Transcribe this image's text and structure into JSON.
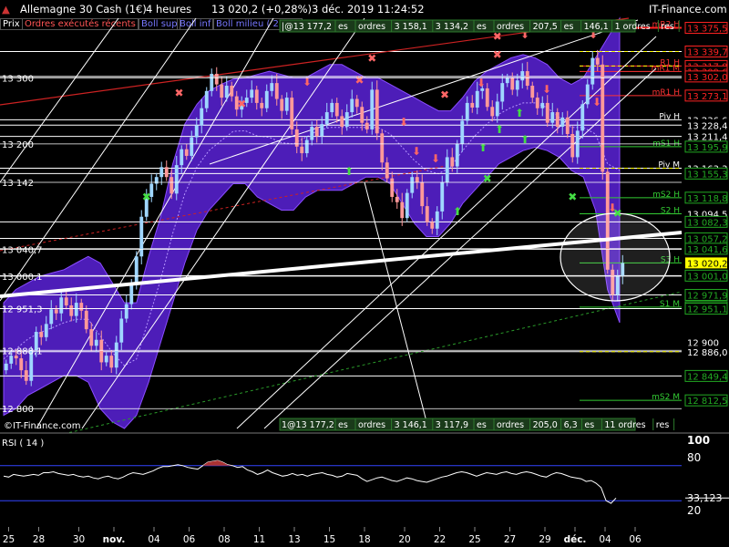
{
  "header": {
    "title": "Allemagne 30 Cash (1€)",
    "period": "4 heures",
    "last": "13 020,2 (+0,28%)",
    "datetime": "3 déc. 2019 11:24:52",
    "brand": "IT-Finance.com"
  },
  "tabs": [
    {
      "label": "Prix",
      "color": "#ffffff"
    },
    {
      "label": "Ordres exécutés récents",
      "color": "#ff5555"
    },
    {
      "label": "Boll sup",
      "color": "#7777ff"
    },
    {
      "label": "Boll inf",
      "color": "#7777ff"
    },
    {
      "label": "Boll milieu ( 20 ,2)",
      "color": "#7777ff"
    }
  ],
  "order_bar_top": [
    "|@13 177,2",
    "es",
    "ordres",
    "3 158,1",
    "3 134,2",
    "es",
    "ordres",
    "207,5",
    "es",
    "146,1",
    "1 ordres",
    "res"
  ],
  "order_bar_bottom": [
    "1@13 177,2",
    "es",
    "ordres",
    "3 146,1",
    "3 117,9",
    "es",
    "ordres",
    "205,0",
    "6,3",
    "es",
    "11 ordres",
    "res"
  ],
  "watermark": "©IT-Finance.com",
  "chart_data": {
    "type": "candlestick",
    "instrument": "Allemagne 30 Cash (1€)",
    "timeframe": "4 heures",
    "ylim": [
      12770,
      13390
    ],
    "yticks": [
      {
        "value": 13300,
        "label": "13 300"
      },
      {
        "value": 13200,
        "label": "13 200"
      },
      {
        "value": 13142,
        "label": "13 142"
      },
      {
        "value": 13040.7,
        "label": "13 040,7"
      },
      {
        "value": 13000.1,
        "label": "13 000,1"
      },
      {
        "value": 12951.3,
        "label": "12 951,3"
      },
      {
        "value": 12888.1,
        "label": "12 888,1"
      },
      {
        "value": 12800,
        "label": "12 800"
      }
    ],
    "xticks": [
      "25",
      "28",
      "30",
      "nov.",
      "04",
      "06",
      "08",
      "11",
      "13",
      "15",
      "18",
      "20",
      "22",
      "25",
      "27",
      "29",
      "déc.",
      "04",
      "06"
    ],
    "xlim_bars": [
      0,
      124
    ],
    "xtick_bars": [
      1,
      7,
      15,
      22,
      30,
      37,
      44,
      51,
      58,
      65,
      72,
      80,
      87,
      94,
      101,
      108,
      114,
      120,
      126
    ],
    "closes": [
      12868,
      12880,
      12876,
      12858,
      12842,
      12888,
      12916,
      12908,
      12928,
      12950,
      12944,
      12968,
      12956,
      12940,
      12960,
      12948,
      12920,
      12895,
      12904,
      12870,
      12880,
      12862,
      12900,
      12936,
      12958,
      12990,
      13030,
      13090,
      13120,
      13140,
      13150,
      13165,
      13150,
      13125,
      13168,
      13192,
      13182,
      13210,
      13228,
      13254,
      13280,
      13306,
      13290,
      13270,
      13288,
      13272,
      13252,
      13262,
      13270,
      13282,
      13262,
      13254,
      13280,
      13292,
      13268,
      13250,
      13270,
      13222,
      13196,
      13186,
      13206,
      13226,
      13212,
      13230,
      13248,
      13262,
      13242,
      13226,
      13248,
      13268,
      13256,
      13232,
      13222,
      13282,
      13216,
      13172,
      13148,
      13120,
      13112,
      13088,
      13126,
      13150,
      13142,
      13106,
      13082,
      13072,
      13098,
      13142,
      13180,
      13166,
      13200,
      13235,
      13262,
      13255,
      13280,
      13284,
      13256,
      13242,
      13264,
      13292,
      13300,
      13282,
      13296,
      13310,
      13288,
      13270,
      13254,
      13262,
      13232,
      13248,
      13226,
      13240,
      13215,
      13180,
      13220,
      13260,
      13290,
      13330,
      13320,
      13158,
      13010,
      12972,
      13000,
      13020
    ],
    "bollinger": {
      "upper": [
        12960,
        12980,
        12990,
        13000,
        13005,
        13010,
        13020,
        13030,
        13020,
        12990,
        12960,
        12960,
        13030,
        13090,
        13170,
        13230,
        13260,
        13280,
        13290,
        13298,
        13300,
        13305,
        13310,
        13305,
        13300,
        13300,
        13310,
        13320,
        13320,
        13310,
        13300,
        13300,
        13290,
        13280,
        13270,
        13260,
        13250,
        13250,
        13270,
        13295,
        13310,
        13320,
        13330,
        13335,
        13330,
        13320,
        13300,
        13290,
        13300,
        13330,
        13360,
        13390
      ],
      "lower": [
        12790,
        12800,
        12820,
        12830,
        12840,
        12850,
        12850,
        12840,
        12800,
        12780,
        12770,
        12790,
        12840,
        12900,
        12960,
        13020,
        13070,
        13100,
        13120,
        13140,
        13140,
        13120,
        13110,
        13100,
        13100,
        13120,
        13130,
        13130,
        13130,
        13140,
        13150,
        13150,
        13140,
        13110,
        13080,
        13060,
        13060,
        13080,
        13110,
        13130,
        13150,
        13170,
        13180,
        13190,
        13195,
        13190,
        13180,
        13160,
        13150,
        13100,
        12980,
        12930
      ],
      "middle": [
        12875,
        12890,
        12905,
        12915,
        12922,
        12930,
        12935,
        12935,
        12910,
        12885,
        12865,
        12875,
        12935,
        12995,
        13065,
        13125,
        13165,
        13190,
        13205,
        13219,
        13220,
        13212,
        13210,
        13202,
        13200,
        13210,
        13220,
        13225,
        13225,
        13225,
        13225,
        13225,
        13215,
        13195,
        13175,
        13160,
        13155,
        13165,
        13190,
        13212,
        13230,
        13245,
        13255,
        13262,
        13262,
        13255,
        13240,
        13225,
        13225,
        13215,
        13170,
        13160
      ]
    },
    "pivots": [
      {
        "label": "mR2 H",
        "value": 13375.5,
        "color": "#ff3333"
      },
      {
        "label": "",
        "value": 13339.7,
        "color": "#ffffff"
      },
      {
        "label": "R1 H",
        "value": 13317.8,
        "color": "#ff3333"
      },
      {
        "label": "mR1 M",
        "value": 13309.6,
        "color": "#ff3333"
      },
      {
        "label": "",
        "value": 13302.0,
        "color": "#ffffff"
      },
      {
        "label": "mR1 H",
        "value": 13273.1,
        "color": "#ff3333"
      },
      {
        "label": "Piv H",
        "value": 13236.6,
        "color": "#ffffff"
      },
      {
        "label": "",
        "value": 13228.4,
        "color": "#ffffff"
      },
      {
        "label": "",
        "value": 13211.4,
        "color": "#ffffff"
      },
      {
        "label": "mS1 H",
        "value": 13195.9,
        "color": "#33cc33"
      },
      {
        "label": "Piv M",
        "value": 13163.3,
        "color": "#ffffff"
      },
      {
        "label": "",
        "value": 13155.3,
        "color": "#ffffff"
      },
      {
        "label": "mS2 H",
        "value": 13118.8,
        "color": "#33cc33"
      },
      {
        "label": "S2 H",
        "value": 13094.5,
        "color": "#33cc33"
      },
      {
        "label": "",
        "value": 13082.3,
        "color": "#ffffff"
      },
      {
        "label": "",
        "value": 13057.2,
        "color": "#ffffff"
      },
      {
        "label": "",
        "value": 13041.6,
        "color": "#ffffff"
      },
      {
        "label": "S3 H",
        "value": 13020.2,
        "color": "#33cc33"
      },
      {
        "label": "",
        "value": 13001.0,
        "color": "#ffffff"
      },
      {
        "label": "",
        "value": 12971.9,
        "color": "#ffffff"
      },
      {
        "label": "S1 M",
        "value": 12953.4,
        "color": "#33cc33"
      },
      {
        "label": "",
        "value": 12951.1,
        "color": "#ffffff"
      },
      {
        "label": "",
        "value": 12886.0,
        "color": "#ffffff"
      },
      {
        "label": "",
        "value": 12849.4,
        "color": "#ffffff"
      },
      {
        "label": "mS2 M",
        "value": 12812.5,
        "color": "#33cc33"
      }
    ],
    "price_labels": [
      {
        "value": 13375.5,
        "label": "13 375,5",
        "color": "#ff2222"
      },
      {
        "value": 13339.7,
        "label": "13 339,7",
        "color": "#ff2222"
      },
      {
        "value": 13317.8,
        "label": "13 317,8",
        "color": "#ff2222"
      },
      {
        "value": 13309.6,
        "label": "13 309,6",
        "color": "#ff2222"
      },
      {
        "value": 13302.0,
        "label": "13 302,0",
        "color": "#ff2222"
      },
      {
        "value": 13273.1,
        "label": "13 273,1",
        "color": "#ff2222"
      },
      {
        "value": 13236.6,
        "label": "13 236,6",
        "color": "#ffffff"
      },
      {
        "value": 13228.4,
        "label": "13 228,4",
        "color": "#ffffff"
      },
      {
        "value": 13211.4,
        "label": "13 211,4",
        "color": "#ffffff"
      },
      {
        "value": 13195.9,
        "label": "13 195,9",
        "color": "#22aa22"
      },
      {
        "value": 13163.3,
        "label": "13 163,3",
        "color": "#ffffff"
      },
      {
        "value": 13155.3,
        "label": "13 155,3",
        "color": "#22aa22"
      },
      {
        "value": 13118.8,
        "label": "13 118,8",
        "color": "#22aa22"
      },
      {
        "value": 13094.5,
        "label": "13 094,5",
        "color": "#ffffff"
      },
      {
        "value": 13082.3,
        "label": "13 082,3",
        "color": "#22aa22"
      },
      {
        "value": 13057.2,
        "label": "13 057,2",
        "color": "#22aa22"
      },
      {
        "value": 13041.6,
        "label": "13 041,6",
        "color": "#22aa22"
      },
      {
        "value": 13020.2,
        "label": "13 020,2",
        "color": "#ffff00"
      },
      {
        "value": 13001.0,
        "label": "13 001,0",
        "color": "#22aa22"
      },
      {
        "value": 12971.9,
        "label": "12 971,9",
        "color": "#22aa22"
      },
      {
        "value": 12953.4,
        "label": "12 953,4",
        "color": "#22aa22"
      },
      {
        "value": 12951.1,
        "label": "12 951,1",
        "color": "#22aa22"
      },
      {
        "value": 12900,
        "label": "12 900",
        "color": "#ffffff"
      },
      {
        "value": 12886.0,
        "label": "12 886,0",
        "color": "#ffffff"
      },
      {
        "value": 12849.4,
        "label": "12 849,4",
        "color": "#22aa22"
      },
      {
        "value": 12812.5,
        "label": "12 812,5",
        "color": "#22aa22"
      }
    ],
    "last_price": 13020.2,
    "rsi": {
      "title": "RSI ( 14 )",
      "ylim": [
        0,
        100
      ],
      "levels": [
        70,
        30
      ],
      "ticks": [
        {
          "value": 100,
          "label": "100"
        },
        {
          "value": 80,
          "label": "80"
        },
        {
          "value": 20,
          "label": "20"
        }
      ],
      "last": 33.123,
      "last_label": "33,123",
      "values": [
        58,
        57,
        60,
        59,
        58,
        59,
        60,
        59,
        62,
        62,
        63,
        61,
        60,
        59,
        60,
        58,
        57,
        58,
        56,
        55,
        57,
        58,
        56,
        55,
        57,
        60,
        62,
        61,
        60,
        62,
        64,
        67,
        69,
        69,
        70,
        71,
        70,
        68,
        67,
        66,
        70,
        74,
        75,
        76,
        74,
        71,
        70,
        68,
        69,
        65,
        63,
        60,
        62,
        65,
        62,
        60,
        58,
        59,
        61,
        59,
        60,
        58,
        60,
        61,
        62,
        60,
        59,
        57,
        58,
        61,
        60,
        59,
        55,
        52,
        54,
        56,
        57,
        55,
        53,
        52,
        54,
        56,
        55,
        53,
        52,
        51,
        53,
        55,
        57,
        58,
        60,
        62,
        63,
        62,
        60,
        58,
        60,
        62,
        61,
        60,
        62,
        63,
        61,
        60,
        62,
        63,
        62,
        60,
        58,
        57,
        60,
        62,
        61,
        59,
        57,
        56,
        55,
        52,
        53,
        50,
        45,
        30,
        27,
        33
      ]
    },
    "series_colors": {
      "up": "#9fd6ff",
      "down": "#ff9999",
      "band": "#5a22d8",
      "trend": "#ffffff"
    }
  }
}
